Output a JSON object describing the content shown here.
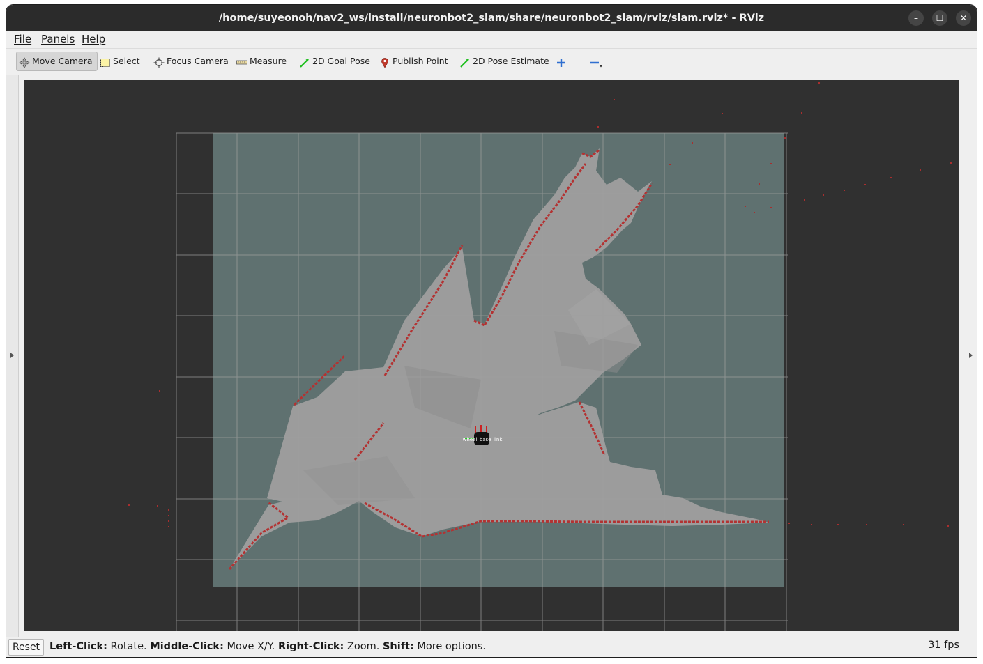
{
  "window": {
    "title": "/home/suyeonoh/nav2_ws/install/neuronbot2_slam/share/neuronbot2_slam/rviz/slam.rviz* - RViz",
    "minimize_glyph": "–",
    "maximize_glyph": "☐",
    "close_glyph": "✕"
  },
  "menu": {
    "items": [
      {
        "label": "File"
      },
      {
        "label": "Panels"
      },
      {
        "label": "Help"
      }
    ]
  },
  "toolbar": {
    "tools": [
      {
        "label": "Move Camera",
        "icon": "move-camera-icon",
        "active": true
      },
      {
        "label": "Select",
        "icon": "select-icon",
        "active": false
      },
      {
        "label": "Focus Camera",
        "icon": "focus-camera-icon",
        "active": false
      },
      {
        "label": "Measure",
        "icon": "measure-icon",
        "active": false
      },
      {
        "label": "2D Goal Pose",
        "icon": "goal-pose-icon",
        "active": false
      },
      {
        "label": "Publish Point",
        "icon": "map-pin-icon",
        "active": false
      },
      {
        "label": "2D Pose Estimate",
        "icon": "pose-estimate-icon",
        "active": false
      }
    ],
    "add_tool_icon": "plus-icon",
    "remove_tool_icon": "minus-icon"
  },
  "viewport": {
    "robot_frame_label": "wheel_base_link",
    "colors": {
      "background": "#303030",
      "unknown_map": "#5f7170",
      "free_space": "#9c9c9c",
      "occupied": "#b33232",
      "grid": "#a0a0a0",
      "axis_green": "#22cc22"
    }
  },
  "statusbar": {
    "reset_label": "Reset",
    "hint_parts": [
      {
        "bold": "Left-Click:",
        "text": " Rotate. "
      },
      {
        "bold": "Middle-Click:",
        "text": " Move X/Y. "
      },
      {
        "bold": "Right-Click:",
        "text": " Zoom. "
      },
      {
        "bold": "Shift:",
        "text": " More options."
      }
    ],
    "fps": "31 fps"
  }
}
